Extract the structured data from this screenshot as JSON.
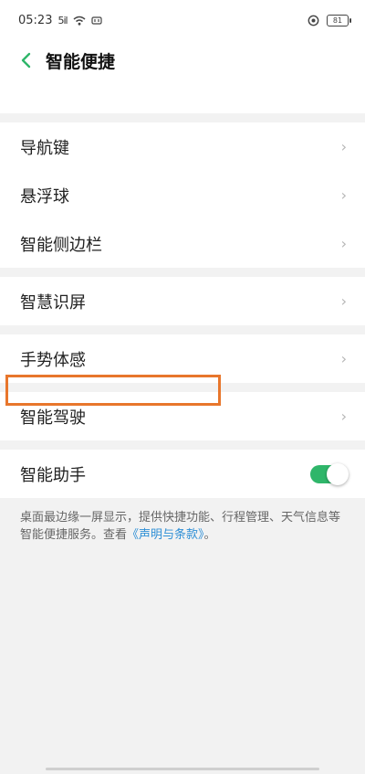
{
  "status_bar": {
    "time": "05:23",
    "signal": "5il",
    "battery": "81"
  },
  "header": {
    "title": "智能便捷",
    "back_icon": "chevron-left-icon"
  },
  "groups": [
    {
      "items": [
        "导航键",
        "悬浮球",
        "智能侧边栏"
      ]
    },
    {
      "items": [
        "智慧识屏"
      ]
    },
    {
      "items": [
        "手势体感"
      ]
    },
    {
      "items": [
        "智能驾驶"
      ]
    }
  ],
  "assistant": {
    "label": "智能助手",
    "enabled": true
  },
  "description": {
    "text": "桌面最边缘一屏显示，提供快捷功能、行程管理、天气信息等智能便捷服务。查看",
    "link": "《声明与条款》",
    "tail": "。"
  },
  "colors": {
    "accent_green": "#2fb66a",
    "highlight_orange": "#e8762c",
    "link_blue": "#2e8fd6"
  }
}
